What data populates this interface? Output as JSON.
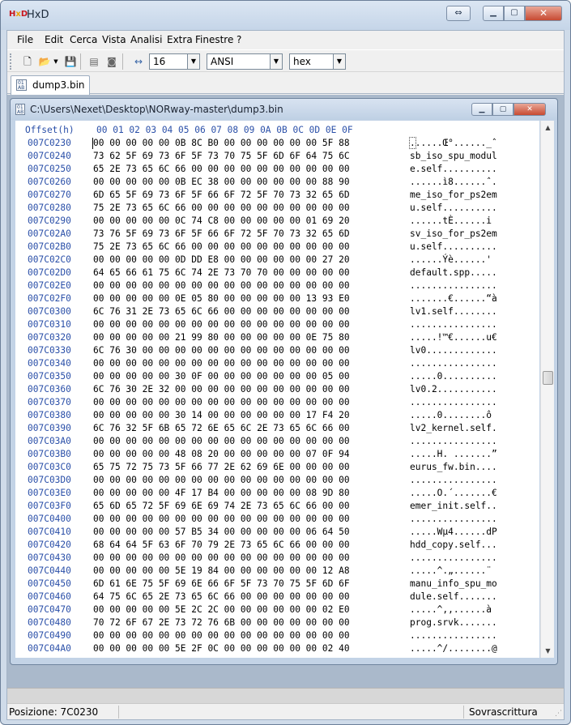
{
  "app": {
    "title": "HxD",
    "logo": "HxD"
  },
  "menu": [
    "File",
    "Edit",
    "Cerca",
    "Vista",
    "Analisi",
    "Extra",
    "Finestre",
    "?"
  ],
  "toolbar": {
    "bytes_per_row": "16",
    "charset": "ANSI",
    "display_mode": "hex"
  },
  "tab": {
    "label": "dump3.bin"
  },
  "child_window": {
    "path": "C:\\Users\\Nexet\\Desktop\\NORway-master\\dump3.bin"
  },
  "hex": {
    "offset_header": "Offset(h)",
    "column_header": "00 01 02 03 04 05 06 07 08 09 0A 0B 0C 0D 0E 0F",
    "rows": [
      {
        "offset": "007C0230",
        "bytes": "00 00 00 00 00 0B 8C B0 00 00 00 00 00 00 5F 88",
        "text": "......Œ°......_ˆ"
      },
      {
        "offset": "007C0240",
        "bytes": "73 62 5F 69 73 6F 5F 73 70 75 5F 6D 6F 64 75 6C",
        "text": "sb_iso_spu_modul"
      },
      {
        "offset": "007C0250",
        "bytes": "65 2E 73 65 6C 66 00 00 00 00 00 00 00 00 00 00",
        "text": "e.self.........."
      },
      {
        "offset": "007C0260",
        "bytes": "00 00 00 00 00 0B EC 38 00 00 00 00 00 00 88 90",
        "text": "......ì8......ˆ."
      },
      {
        "offset": "007C0270",
        "bytes": "6D 65 5F 69 73 6F 5F 66 6F 72 5F 70 73 32 65 6D",
        "text": "me_iso_for_ps2em"
      },
      {
        "offset": "007C0280",
        "bytes": "75 2E 73 65 6C 66 00 00 00 00 00 00 00 00 00 00",
        "text": "u.self.........."
      },
      {
        "offset": "007C0290",
        "bytes": "00 00 00 00 00 0C 74 C8 00 00 00 00 00 01 69 20",
        "text": "......tÈ......i "
      },
      {
        "offset": "007C02A0",
        "bytes": "73 76 5F 69 73 6F 5F 66 6F 72 5F 70 73 32 65 6D",
        "text": "sv_iso_for_ps2em"
      },
      {
        "offset": "007C02B0",
        "bytes": "75 2E 73 65 6C 66 00 00 00 00 00 00 00 00 00 00",
        "text": "u.self.........."
      },
      {
        "offset": "007C02C0",
        "bytes": "00 00 00 00 00 0D DD E8 00 00 00 00 00 00 27 20",
        "text": "......Ýè......' "
      },
      {
        "offset": "007C02D0",
        "bytes": "64 65 66 61 75 6C 74 2E 73 70 70 00 00 00 00 00",
        "text": "default.spp....."
      },
      {
        "offset": "007C02E0",
        "bytes": "00 00 00 00 00 00 00 00 00 00 00 00 00 00 00 00",
        "text": "................"
      },
      {
        "offset": "007C02F0",
        "bytes": "00 00 00 00 00 0E 05 80 00 00 00 00 00 13 93 E0",
        "text": ".......€......“à"
      },
      {
        "offset": "007C0300",
        "bytes": "6C 76 31 2E 73 65 6C 66 00 00 00 00 00 00 00 00",
        "text": "lv1.self........"
      },
      {
        "offset": "007C0310",
        "bytes": "00 00 00 00 00 00 00 00 00 00 00 00 00 00 00 00",
        "text": "................"
      },
      {
        "offset": "007C0320",
        "bytes": "00 00 00 00 00 21 99 80 00 00 00 00 00 0E 75 80",
        "text": ".....!™€......u€"
      },
      {
        "offset": "007C0330",
        "bytes": "6C 76 30 00 00 00 00 00 00 00 00 00 00 00 00 00",
        "text": "lv0............."
      },
      {
        "offset": "007C0340",
        "bytes": "00 00 00 00 00 00 00 00 00 00 00 00 00 00 00 00",
        "text": "................"
      },
      {
        "offset": "007C0350",
        "bytes": "00 00 00 00 00 30 0F 00 00 00 00 00 00 00 05 00",
        "text": ".....0.........."
      },
      {
        "offset": "007C0360",
        "bytes": "6C 76 30 2E 32 00 00 00 00 00 00 00 00 00 00 00",
        "text": "lv0.2..........."
      },
      {
        "offset": "007C0370",
        "bytes": "00 00 00 00 00 00 00 00 00 00 00 00 00 00 00 00",
        "text": "................"
      },
      {
        "offset": "007C0380",
        "bytes": "00 00 00 00 00 30 14 00 00 00 00 00 00 17 F4 20",
        "text": ".....0........ô "
      },
      {
        "offset": "007C0390",
        "bytes": "6C 76 32 5F 6B 65 72 6E 65 6C 2E 73 65 6C 66 00",
        "text": "lv2_kernel.self."
      },
      {
        "offset": "007C03A0",
        "bytes": "00 00 00 00 00 00 00 00 00 00 00 00 00 00 00 00",
        "text": "................"
      },
      {
        "offset": "007C03B0",
        "bytes": "00 00 00 00 00 48 08 20 00 00 00 00 00 07 0F 94",
        "text": ".....H. .......”"
      },
      {
        "offset": "007C03C0",
        "bytes": "65 75 72 75 73 5F 66 77 2E 62 69 6E 00 00 00 00",
        "text": "eurus_fw.bin...."
      },
      {
        "offset": "007C03D0",
        "bytes": "00 00 00 00 00 00 00 00 00 00 00 00 00 00 00 00",
        "text": "................"
      },
      {
        "offset": "007C03E0",
        "bytes": "00 00 00 00 00 4F 17 B4 00 00 00 00 00 08 9D 80",
        "text": ".....O.´.......€"
      },
      {
        "offset": "007C03F0",
        "bytes": "65 6D 65 72 5F 69 6E 69 74 2E 73 65 6C 66 00 00",
        "text": "emer_init.self.."
      },
      {
        "offset": "007C0400",
        "bytes": "00 00 00 00 00 00 00 00 00 00 00 00 00 00 00 00",
        "text": "................"
      },
      {
        "offset": "007C0410",
        "bytes": "00 00 00 00 00 57 B5 34 00 00 00 00 00 06 64 50",
        "text": ".....Wµ4......dP"
      },
      {
        "offset": "007C0420",
        "bytes": "68 64 64 5F 63 6F 70 79 2E 73 65 6C 66 00 00 00",
        "text": "hdd_copy.self..."
      },
      {
        "offset": "007C0430",
        "bytes": "00 00 00 00 00 00 00 00 00 00 00 00 00 00 00 00",
        "text": "................"
      },
      {
        "offset": "007C0440",
        "bytes": "00 00 00 00 00 5E 19 84 00 00 00 00 00 00 12 A8",
        "text": ".....^.„......¨"
      },
      {
        "offset": "007C0450",
        "bytes": "6D 61 6E 75 5F 69 6E 66 6F 5F 73 70 75 5F 6D 6F",
        "text": "manu_info_spu_mo"
      },
      {
        "offset": "007C0460",
        "bytes": "64 75 6C 65 2E 73 65 6C 66 00 00 00 00 00 00 00",
        "text": "dule.self......."
      },
      {
        "offset": "007C0470",
        "bytes": "00 00 00 00 00 5E 2C 2C 00 00 00 00 00 00 02 E0",
        "text": ".....^,,......à"
      },
      {
        "offset": "007C0480",
        "bytes": "70 72 6F 67 2E 73 72 76 6B 00 00 00 00 00 00 00",
        "text": "prog.srvk......."
      },
      {
        "offset": "007C0490",
        "bytes": "00 00 00 00 00 00 00 00 00 00 00 00 00 00 00 00",
        "text": "................"
      },
      {
        "offset": "007C04A0",
        "bytes": "00 00 00 00 00 5E 2F 0C 00 00 00 00 00 00 02 40",
        "text": ".....^/........@"
      }
    ]
  },
  "status": {
    "position": "Posizione: 7C0230",
    "mode": "Sovrascrittura"
  },
  "colors": {
    "offset_blue": "#2a4fa8",
    "title_bg": "#c5d5e8",
    "close_red": "#c74a32"
  },
  "icons": [
    "new-file-icon",
    "open-folder-icon",
    "save-icon",
    "ram-icon",
    "disk-icon",
    "bytes-per-row-icon"
  ]
}
